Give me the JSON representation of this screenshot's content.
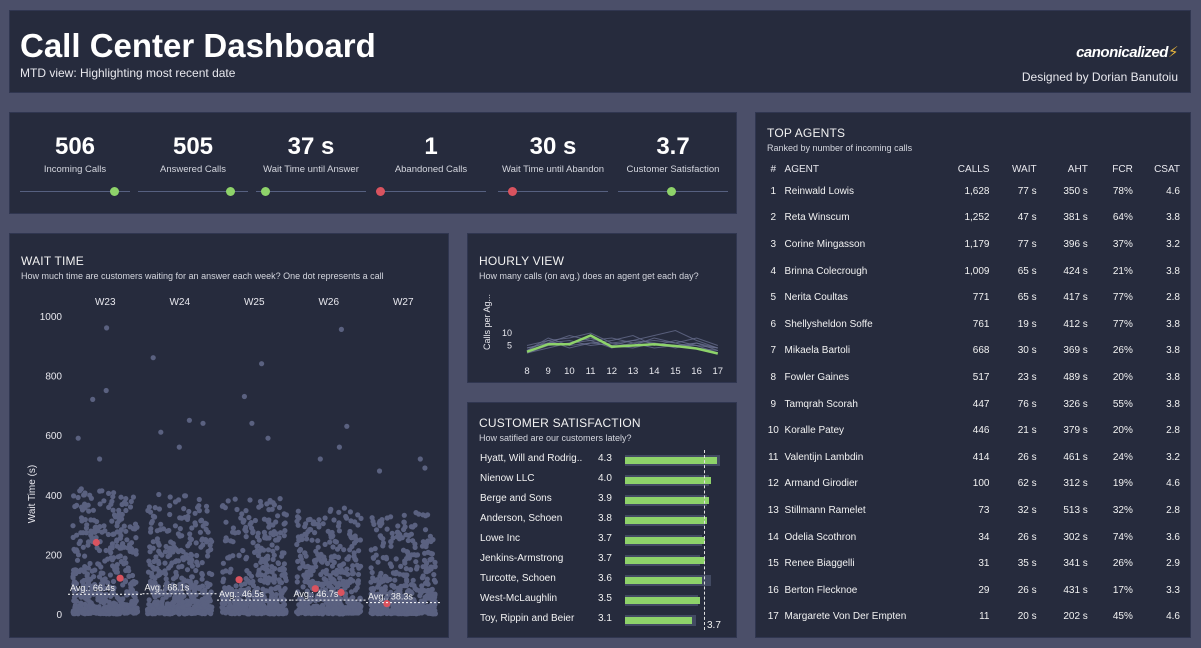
{
  "header": {
    "title": "Call Center Dashboard",
    "subtitle": "MTD view: Highlighting most recent date",
    "logo_text": "canonicalized",
    "credit": "Designed by Dorian Banutoiu"
  },
  "kpis": [
    {
      "value": "506",
      "label": "Incoming Calls",
      "indicator": "green",
      "position_pct": 85
    },
    {
      "value": "505",
      "label": "Answered Calls",
      "indicator": "green",
      "position_pct": 84
    },
    {
      "value": "37 s",
      "label": "Wait Time until Answer",
      "indicator": "green",
      "position_pct": 8
    },
    {
      "value": "1",
      "label": "Abandoned Calls",
      "indicator": "red",
      "position_pct": 4
    },
    {
      "value": "30 s",
      "label": "Wait Time until Abandon",
      "indicator": "red",
      "position_pct": 13
    },
    {
      "value": "3.7",
      "label": "Customer Satisfaction",
      "indicator": "green",
      "position_pct": 48
    }
  ],
  "wait_time": {
    "title": "WAIT TIME",
    "subtitle": "How much time are customers waiting  for an answer each week? One dot represents a call",
    "ylabel": "Wait Time (s)",
    "yticks": [
      0,
      200,
      400,
      600,
      800,
      1000
    ],
    "weeks": [
      "W23",
      "W24",
      "W25",
      "W26",
      "W27"
    ],
    "averages": [
      66.4,
      68.1,
      46.5,
      46.7,
      38.3
    ],
    "avg_labels": [
      "Avg.: 66.4s",
      "Avg.: 68.1s",
      "Avg.: 46.5s",
      "Avg.: 46.7s",
      "Avg.: 38.3s"
    ],
    "highlights": [
      [
        240,
        120
      ],
      [],
      [
        115
      ],
      [
        85,
        72
      ],
      [
        35
      ]
    ],
    "outliers": [
      [
        960,
        750,
        720,
        590,
        520
      ],
      [
        860,
        650,
        640,
        610,
        560
      ],
      [
        840,
        730,
        640,
        590
      ],
      [
        955,
        630,
        560,
        520
      ],
      [
        520,
        490,
        480
      ]
    ],
    "dot_color": "#5a6180",
    "highlight_color": "#d9535f"
  },
  "hourly": {
    "title": "HOURLY VIEW",
    "subtitle": "How many calls (on avg.) does an agent get each day?",
    "ylabel": "Calls per Ag...",
    "yticks": [
      5,
      10
    ],
    "hours": [
      8,
      9,
      10,
      11,
      12,
      13,
      14,
      15,
      16,
      17
    ],
    "highlight": [
      2.5,
      5.5,
      5.5,
      9,
      4.5,
      5,
      5.5,
      4.8,
      3.8,
      1.8
    ],
    "background_series": [
      [
        3,
        7,
        8,
        10,
        6,
        7,
        9,
        11,
        7,
        4
      ],
      [
        4,
        6,
        9,
        7,
        8,
        6,
        7,
        6,
        8,
        5
      ],
      [
        2,
        5,
        6,
        8,
        5,
        4,
        6,
        5,
        6,
        3
      ],
      [
        3,
        8,
        5,
        6,
        7,
        9,
        5,
        7,
        5,
        4
      ],
      [
        4,
        6,
        7,
        5,
        6,
        5,
        8,
        6,
        4,
        3
      ],
      [
        2,
        4,
        6,
        7,
        4,
        6,
        4,
        5,
        5,
        2
      ],
      [
        5,
        7,
        4,
        6,
        5,
        7,
        6,
        4,
        6,
        4
      ]
    ],
    "highlight_color": "#8ed36a"
  },
  "customer_satisfaction": {
    "title": "CUSTOMER SATISFACTION",
    "subtitle": "How satified are our customers lately?",
    "average_label": "3.7",
    "rows": [
      {
        "name": "Hyatt, Will and Rodrig..",
        "score": "4.3",
        "value": 4.3,
        "prior": 4.4
      },
      {
        "name": "Nienow LLC",
        "score": "4.0",
        "value": 4.0,
        "prior": 3.9
      },
      {
        "name": "Berge and Sons",
        "score": "3.9",
        "value": 3.9,
        "prior": 3.8
      },
      {
        "name": "Anderson, Schoen",
        "score": "3.8",
        "value": 3.8,
        "prior": 3.7
      },
      {
        "name": "Lowe Inc",
        "score": "3.7",
        "value": 3.7,
        "prior": 3.6
      },
      {
        "name": "Jenkins-Armstrong",
        "score": "3.7",
        "value": 3.7,
        "prior": 3.5
      },
      {
        "name": "Turcotte, Schoen",
        "score": "3.6",
        "value": 3.6,
        "prior": 4.0
      },
      {
        "name": "West-McLaughlin",
        "score": "3.5",
        "value": 3.5,
        "prior": 3.4
      },
      {
        "name": "Toy, Rippin and Beier",
        "score": "3.1",
        "value": 3.1,
        "prior": 3.3
      }
    ]
  },
  "agents": {
    "title": "TOP AGENTS",
    "subtitle": "Ranked by number of incoming calls",
    "columns": [
      "#",
      "AGENT",
      "CALLS",
      "WAIT",
      "AHT",
      "FCR",
      "CSAT"
    ],
    "rows": [
      [
        "1",
        "Reinwald Lowis",
        "1,628",
        "77 s",
        "350 s",
        "78%",
        "4.6"
      ],
      [
        "2",
        "Reta Winscum",
        "1,252",
        "47 s",
        "381 s",
        "64%",
        "3.8"
      ],
      [
        "3",
        "Corine Mingasson",
        "1,179",
        "77 s",
        "396 s",
        "37%",
        "3.2"
      ],
      [
        "4",
        "Brinna Colecrough",
        "1,009",
        "65 s",
        "424 s",
        "21%",
        "3.8"
      ],
      [
        "5",
        "Nerita Coultas",
        "771",
        "65 s",
        "417 s",
        "77%",
        "2.8"
      ],
      [
        "6",
        "Shellysheldon Soffe",
        "761",
        "19 s",
        "412 s",
        "77%",
        "3.8"
      ],
      [
        "7",
        "Mikaela Bartoli",
        "668",
        "30 s",
        "369 s",
        "26%",
        "3.8"
      ],
      [
        "8",
        "Fowler Gaines",
        "517",
        "23 s",
        "489 s",
        "20%",
        "3.8"
      ],
      [
        "9",
        "Tamqrah Scorah",
        "447",
        "76 s",
        "326 s",
        "55%",
        "3.8"
      ],
      [
        "10",
        "Koralle Patey",
        "446",
        "21 s",
        "379 s",
        "20%",
        "2.8"
      ],
      [
        "11",
        "Valentijn Lambdin",
        "414",
        "26 s",
        "461 s",
        "24%",
        "3.2"
      ],
      [
        "12",
        "Armand Girodier",
        "100",
        "62 s",
        "312 s",
        "19%",
        "4.6"
      ],
      [
        "13",
        "Stillmann Ramelet",
        "73",
        "32 s",
        "513 s",
        "32%",
        "2.8"
      ],
      [
        "14",
        "Odelia Scothron",
        "34",
        "26 s",
        "302 s",
        "74%",
        "3.6"
      ],
      [
        "15",
        "Renee Biaggelli",
        "31",
        "35 s",
        "341 s",
        "26%",
        "2.9"
      ],
      [
        "16",
        "Berton Flecknoe",
        "29",
        "26 s",
        "431 s",
        "17%",
        "3.3"
      ],
      [
        "17",
        "Margarete Von Der Empten",
        "11",
        "20 s",
        "202 s",
        "45%",
        "4.6"
      ]
    ]
  }
}
